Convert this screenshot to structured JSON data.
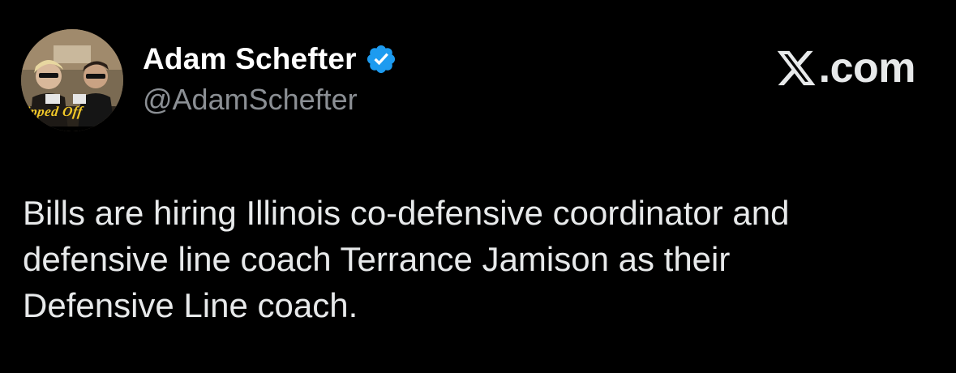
{
  "author": {
    "display_name": "Adam Schefter",
    "handle": "@AdamSchefter",
    "verified": true,
    "avatar_overlay_text": "ipped Off"
  },
  "branding": {
    "logo_icon": "x-logo-icon",
    "logo_suffix": ".com"
  },
  "tweet": {
    "text": "Bills are hiring Illinois co-defensive coordinator and\ndefensive line coach Terrance Jamison as their\nDefensive Line coach."
  },
  "colors": {
    "background": "#000000",
    "primary_text": "#e7e9ea",
    "secondary_text": "#8b8f94",
    "verified_blue": "#1d9bf0"
  }
}
